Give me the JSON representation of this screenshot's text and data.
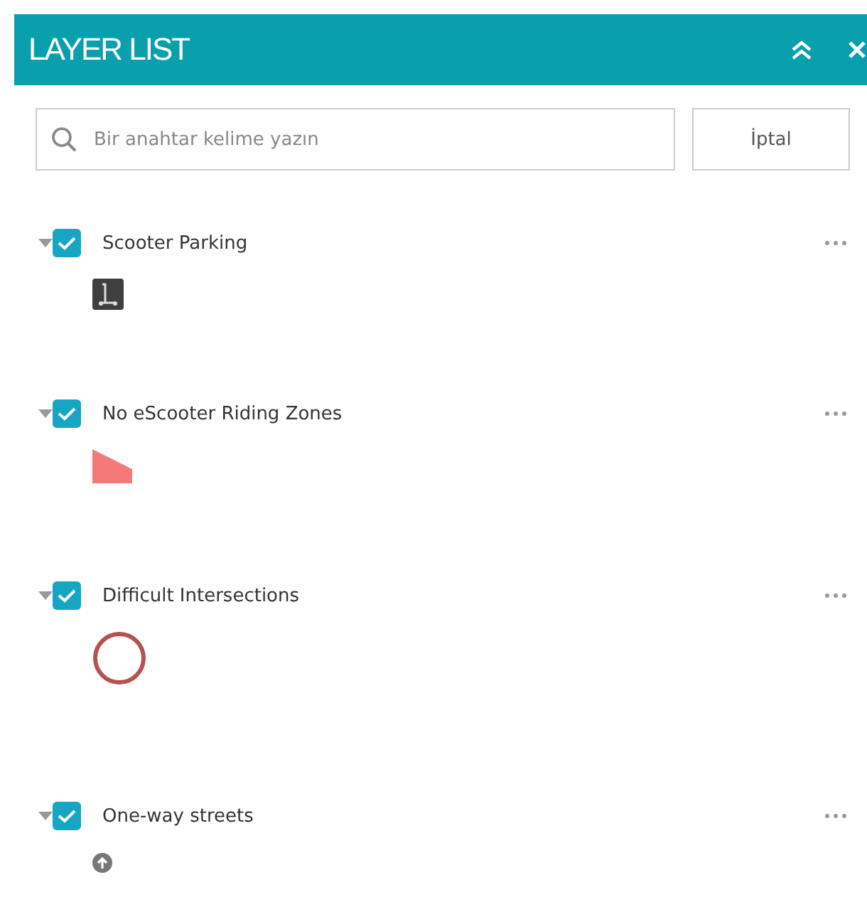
{
  "panel": {
    "title": "LAYER LIST"
  },
  "search": {
    "placeholder": "Bir anahtar kelime yazın"
  },
  "cancel_button": "İptal",
  "layers": [
    {
      "name": "Scooter Parking",
      "checked": true,
      "expanded": true,
      "legend": {
        "kind": "scooter"
      }
    },
    {
      "name": "No eScooter Riding Zones",
      "checked": true,
      "expanded": true,
      "legend": {
        "kind": "polygon"
      }
    },
    {
      "name": "Difficult Intersections",
      "checked": true,
      "expanded": true,
      "legend": {
        "kind": "circle"
      }
    },
    {
      "name": "One-way streets",
      "checked": true,
      "expanded": true,
      "legend": {
        "kind": "arrow"
      }
    }
  ]
}
